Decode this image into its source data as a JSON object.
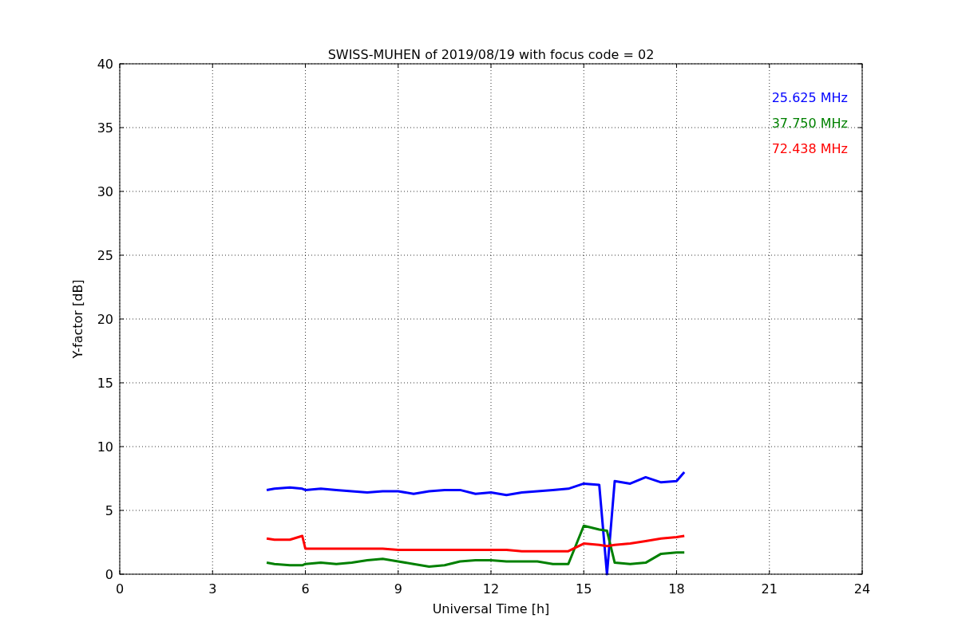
{
  "chart_data": {
    "type": "line",
    "title": "SWISS-MUHEN of 2019/08/19 with focus code = 02",
    "xlabel": "Universal Time [h]",
    "ylabel": "Y-factor [dB]",
    "x": [
      4.75,
      5,
      5.5,
      5.9,
      6,
      6.5,
      7,
      7.5,
      8,
      8.5,
      9,
      9.5,
      10,
      10.5,
      11,
      11.5,
      12,
      12.5,
      13,
      13.5,
      14,
      14.5,
      15,
      15.5,
      15.75,
      16,
      16.5,
      17,
      17.5,
      18,
      18.25
    ],
    "series": [
      {
        "name": "25.625 MHz",
        "color": "#0000ff",
        "values": [
          6.6,
          6.7,
          6.8,
          6.7,
          6.6,
          6.7,
          6.6,
          6.5,
          6.4,
          6.5,
          6.5,
          6.3,
          6.5,
          6.6,
          6.6,
          6.3,
          6.4,
          6.2,
          6.4,
          6.5,
          6.6,
          6.7,
          7.1,
          7.0,
          0.0,
          7.3,
          7.1,
          7.6,
          7.2,
          7.3,
          8.0
        ]
      },
      {
        "name": "37.750 MHz",
        "color": "#008000",
        "values": [
          0.9,
          0.8,
          0.7,
          0.7,
          0.8,
          0.9,
          0.8,
          0.9,
          1.1,
          1.2,
          1.0,
          0.8,
          0.6,
          0.7,
          1.0,
          1.1,
          1.1,
          1.0,
          1.0,
          1.0,
          0.8,
          0.8,
          3.8,
          3.5,
          3.4,
          0.9,
          0.8,
          0.9,
          1.6,
          1.7,
          1.7
        ]
      },
      {
        "name": "72.438 MHz",
        "color": "#ff0000",
        "values": [
          2.8,
          2.7,
          2.7,
          3.0,
          2.0,
          2.0,
          2.0,
          2.0,
          2.0,
          2.0,
          1.9,
          1.9,
          1.9,
          1.9,
          1.9,
          1.9,
          1.9,
          1.9,
          1.8,
          1.8,
          1.8,
          1.8,
          2.4,
          2.3,
          2.2,
          2.3,
          2.4,
          2.6,
          2.8,
          2.9,
          3.0
        ]
      }
    ],
    "xlim": [
      0,
      24
    ],
    "ylim": [
      0,
      40
    ],
    "xticks": [
      0,
      3,
      6,
      9,
      12,
      15,
      18,
      21,
      24
    ],
    "yticks": [
      0,
      5,
      10,
      15,
      20,
      25,
      30,
      35,
      40
    ],
    "grid": true
  }
}
